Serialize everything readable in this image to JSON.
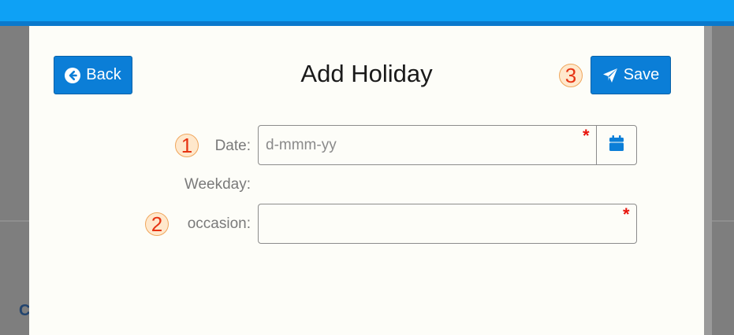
{
  "background": {
    "partial_letter": "C"
  },
  "modal": {
    "title": "Add Holiday",
    "back_label": "Back",
    "save_label": "Save"
  },
  "steps": [
    "1",
    "2",
    "3"
  ],
  "form": {
    "date_label": "Date:",
    "date_placeholder": "d-mmm-yy",
    "weekday_label": "Weekday:",
    "weekday_value": "",
    "occasion_label": "occasion:",
    "occasion_value": "",
    "required_marker": "*"
  },
  "colors": {
    "primary": "#0b7ed7",
    "topbar": "#0ea1f5",
    "required": "#e8140c",
    "step_badge_text": "#e63312"
  },
  "icons": {
    "back": "arrow-circle-left-icon",
    "save": "paper-plane-icon",
    "calendar": "calendar-icon"
  }
}
